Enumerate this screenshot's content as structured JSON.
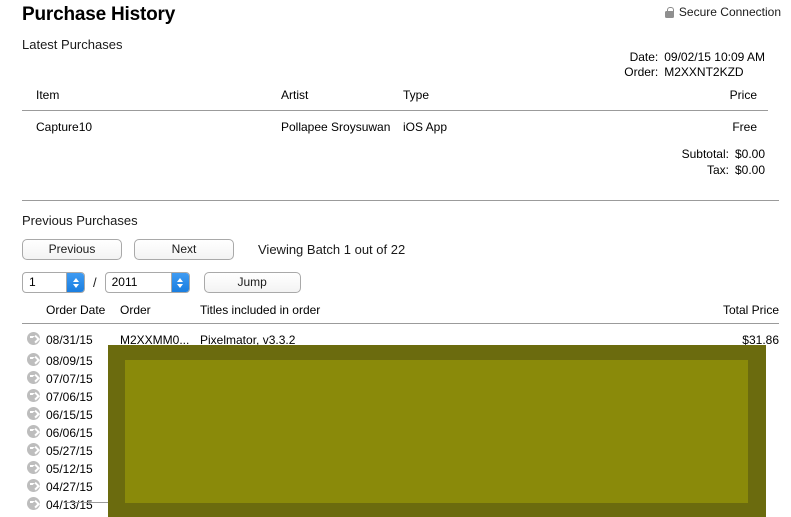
{
  "page": {
    "title": "Purchase History"
  },
  "secure": {
    "icon": "lock-icon",
    "label": "Secure Connection"
  },
  "latest": {
    "heading": "Latest Purchases",
    "meta": {
      "date_label": "Date:",
      "date_value": "09/02/15 10:09 AM",
      "order_label": "Order:",
      "order_value": "M2XXNT2KZD"
    },
    "columns": {
      "item": "Item",
      "artist": "Artist",
      "type": "Type",
      "price": "Price"
    },
    "rows": [
      {
        "item": "Capture10",
        "artist": "Pollapee Sroysuwan",
        "type": "iOS App",
        "price": "Free"
      }
    ],
    "totals": {
      "subtotal_label": "Subtotal:",
      "subtotal_value": "$0.00",
      "tax_label": "Tax:",
      "tax_value": "$0.00"
    }
  },
  "previous": {
    "heading": "Previous Purchases",
    "controls": {
      "previous_label": "Previous",
      "next_label": "Next",
      "batch_status": "Viewing Batch 1 out of 22",
      "batch_value": "1",
      "separator": "/",
      "year_value": "2011",
      "jump_label": "Jump"
    },
    "columns": {
      "order_date": "Order Date",
      "order": "Order",
      "titles": "Titles included in order",
      "total_price": "Total Price"
    },
    "rows": [
      {
        "icon": "disclosure-arrow-icon",
        "date": "08/31/15",
        "order": "M2XXMM0...",
        "titles": "Pixelmator, v3.3.2",
        "total": "$31.86"
      },
      {
        "icon": "disclosure-arrow-icon",
        "date": "08/09/15",
        "order": "",
        "titles": "",
        "total": ""
      },
      {
        "icon": "disclosure-arrow-icon",
        "date": "07/07/15",
        "order": "",
        "titles": "",
        "total": ""
      },
      {
        "icon": "disclosure-arrow-icon",
        "date": "07/06/15",
        "order": "",
        "titles": "",
        "total": ""
      },
      {
        "icon": "disclosure-arrow-icon",
        "date": "06/15/15",
        "order": "",
        "titles": "",
        "total": ""
      },
      {
        "icon": "disclosure-arrow-icon",
        "date": "06/06/15",
        "order": "",
        "titles": "",
        "total": ""
      },
      {
        "icon": "disclosure-arrow-icon",
        "date": "05/27/15",
        "order": "",
        "titles": "",
        "total": ""
      },
      {
        "icon": "disclosure-arrow-icon",
        "date": "05/12/15",
        "order": "",
        "titles": "",
        "total": ""
      },
      {
        "icon": "disclosure-arrow-icon",
        "date": "04/27/15",
        "order": "",
        "titles": "",
        "total": ""
      },
      {
        "icon": "disclosure-arrow-icon",
        "date": "04/13/15",
        "order": "",
        "titles": "",
        "total": ""
      }
    ]
  },
  "colors": {
    "redaction_outer": "#6b6b0e",
    "redaction_inner": "#8a8a0a",
    "rule": "#9b9b9b",
    "stepper_accent": "#1a7ee0"
  }
}
